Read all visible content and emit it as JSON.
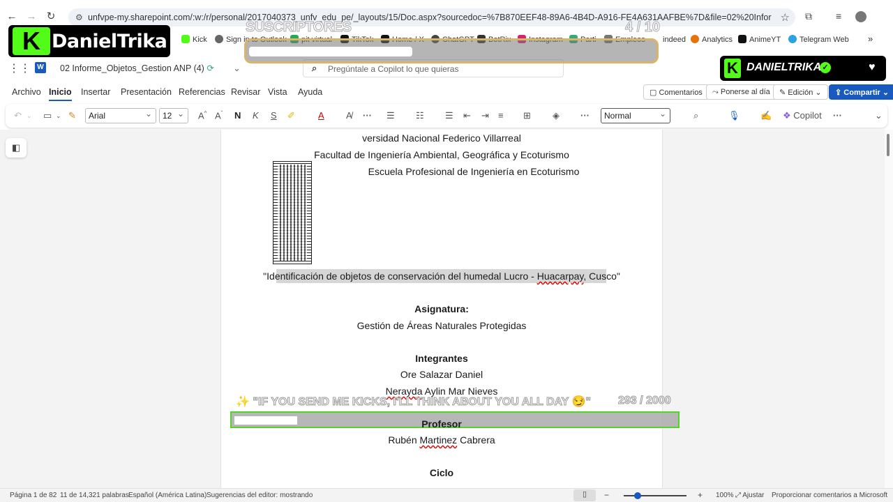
{
  "browser": {
    "url": "unfvpe-my.sharepoint.com/:w:/r/personal/2017040373_unfv_edu_pe/_layouts/15/Doc.aspx?sourcedoc=%7B870EEF48-89A6-4B4D-A916-FE4A631AAFBE%7D&file=02%20Informe_Objetos_Gestion%...",
    "bookmarks": [
      "Kick",
      "Sign in to Outlook",
      "pit virtual",
      "TikTok",
      "Home / X",
      "ChatGPT",
      "BotRix",
      "Instagram",
      "Parti",
      "Empleos",
      "indeed",
      "Analytics",
      "AnimeYT",
      "Telegram Web"
    ]
  },
  "office": {
    "doc_title": "02 Informe_Objetos_Gestion ANP",
    "doc_version": "(4)",
    "copilot_placeholder": "Pregúntale a Copilot lo que quieras",
    "tabs": [
      "Archivo",
      "Inicio",
      "Insertar",
      "Presentación",
      "Referencias",
      "Revisar",
      "Vista",
      "Ayuda"
    ],
    "header_buttons": {
      "comments": "Comentarios",
      "catchup": "Ponerse al día",
      "editing": "Edición",
      "share": "Compartir"
    },
    "toolbar": {
      "font": "Arial",
      "size": "12",
      "style": "Normal",
      "copilot": "Copilot"
    }
  },
  "document": {
    "line1": "versidad Nacional Federico Villarreal",
    "line2": "Facultad de Ingeniería Ambiental, Geográfica y Ecoturismo",
    "line3": "Escuela Profesional de Ingeniería en Ecoturismo",
    "title_a": "\"Identificación de objetos de conservación del humedal Lucro - ",
    "title_b": "Huacarpay",
    "title_c": ", Cusco\"",
    "subject_label": "Asignatura:",
    "subject": "Gestión de Áreas Naturales Protegidas",
    "members_label": "Integrantes",
    "member1": "Ore Salazar Daniel",
    "member2_a": "Nerayda",
    "member2_b": " Aylin Mar Nieves",
    "professor_label": "Profesor",
    "professor_a": "Rubén ",
    "professor_b": "Martinez",
    "professor_c": " Cabrera",
    "cycle_label": "Ciclo"
  },
  "status": {
    "page": "Página 1 de 82",
    "words": "11 de 14,321 palabras",
    "language": "Español (América Latina)",
    "suggestions": "Sugerencias del editor: mostrando",
    "zoom": "100%",
    "fit": "Ajustar",
    "feedback": "Proporcionar comentarios a Microsoft",
    "zoom_level": 1.0
  },
  "overlay": {
    "streamer": "DanielTrika",
    "badge_name": "DANIELTRIKA",
    "subs_label": "SUSCRIPTORES",
    "subs_count": "4  / 10",
    "subs_progress": 0.4,
    "goal_text": "✨ \"IF YOU SEND ME KICKS, I'LL THINK ABOUT YOU ALL DAY 😏\"",
    "goal_count": "293  / 2000",
    "goal_progress": 0.1465,
    "brand_color": "#53fc18"
  }
}
